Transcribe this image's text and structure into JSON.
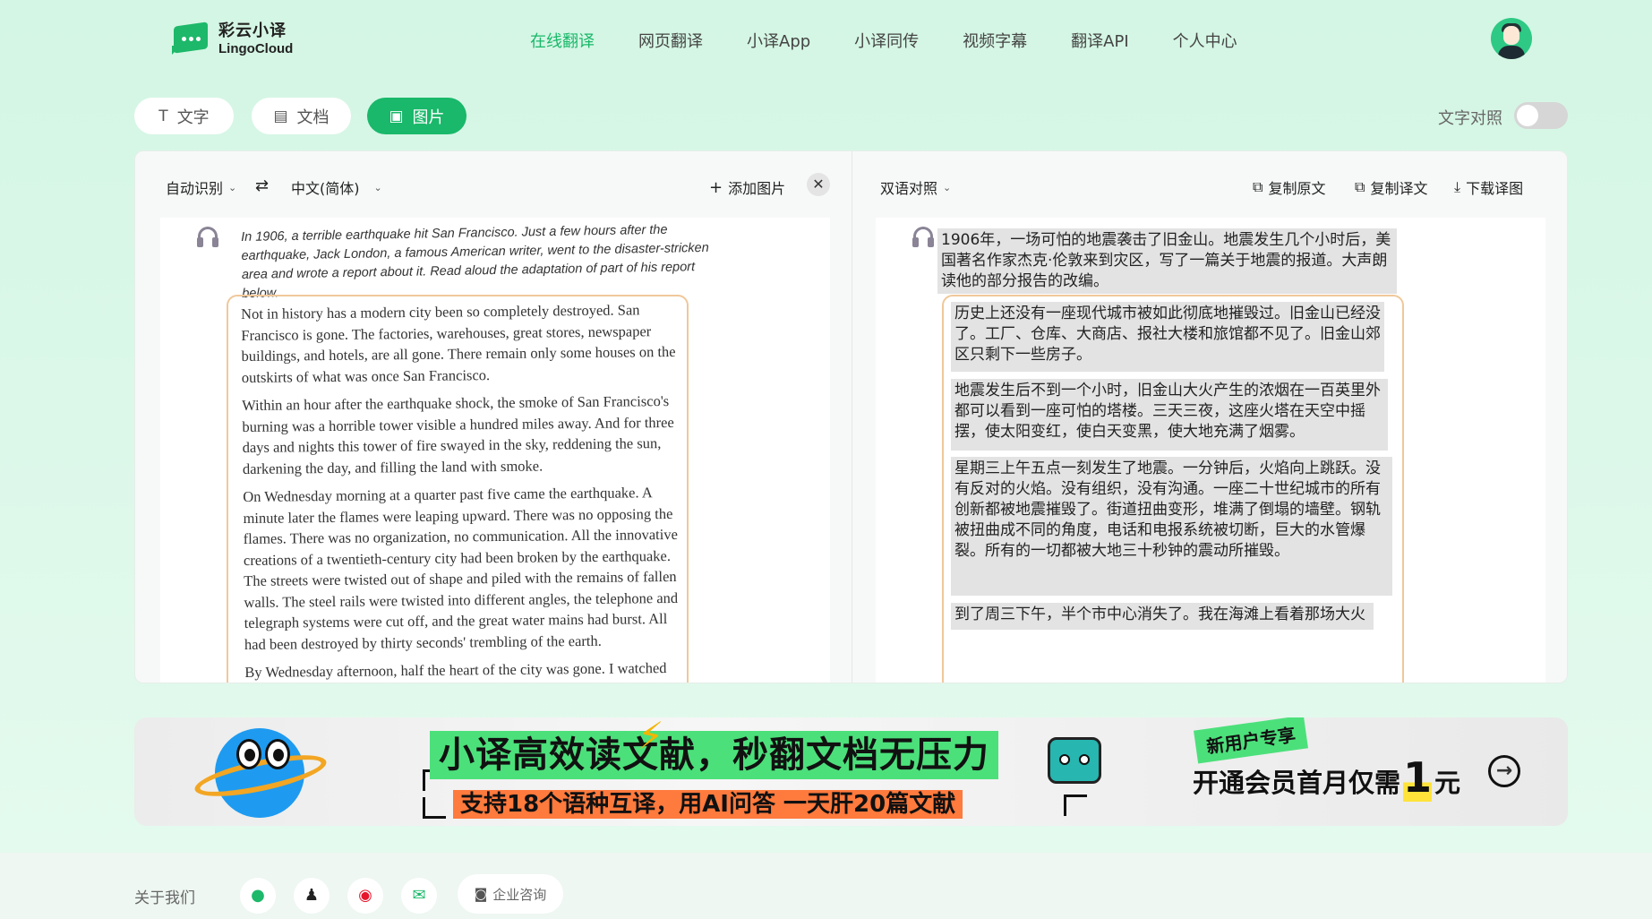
{
  "brand": {
    "cn": "彩云小译",
    "en": "LingoCloud",
    "color": "#19b86a"
  },
  "nav": [
    "在线翻译",
    "网页翻译",
    "小译App",
    "小译同传",
    "视频字幕",
    "翻译API",
    "个人中心"
  ],
  "modes": {
    "text": "文字",
    "doc": "文档",
    "image": "图片",
    "active": "图片"
  },
  "toggle": {
    "label": "文字对照",
    "on": false
  },
  "left_toolbar": {
    "source_lang": "自动识别",
    "swap_icon": "swap-icon",
    "target_lang": "中文(简体)",
    "add_image": "添加图片"
  },
  "right_toolbar": {
    "view_mode": "双语对照",
    "copy_source": "复制原文",
    "copy_translation": "复制译文",
    "download": "下载译图"
  },
  "source_image": {
    "intro": "In 1906, a terrible earthquake hit San Francisco. Just a few hours after the earthquake, Jack London, a famous American writer, went to the disaster-stricken area and wrote a report about it. Read aloud the adaptation of part of his report below.",
    "p1": "Not in history has a modern city been so completely destroyed. San Francisco is gone. The factories, warehouses, great stores, newspaper buildings, and hotels, are all gone. There remain only some houses on the outskirts of what was once San Francisco.",
    "p2": "Within an hour after the earthquake shock, the smoke of San Francisco's burning was a horrible tower visible a hundred miles away. And for three days and nights this tower of fire swayed in the sky, reddening the sun, darkening the day, and filling the land with smoke.",
    "p3": "On Wednesday morning at a quarter past five came the earthquake. A minute later the flames were leaping upward. There was no opposing the flames. There was no organization, no communication. All the innovative creations of a twentieth-century city had been broken by the earthquake. The streets were twisted out of shape and piled with the remains of fallen walls. The steel rails were twisted into different angles, the telephone and telegraph systems were cut off, and the great water mains had burst. All had been destroyed by thirty seconds' trembling of the earth.",
    "p4": "By Wednesday afternoon, half the heart of the city was gone. I watched the"
  },
  "translated_image": {
    "intro": "1906年，一场可怕的地震袭击了旧金山。地震发生几个小时后，美国著名作家杰克·伦敦来到灾区，写了一篇关于地震的报道。大声朗读他的部分报告的改编。",
    "p1": "历史上还没有一座现代城市被如此彻底地摧毁过。旧金山已经没了。工厂、仓库、大商店、报社大楼和旅馆都不见了。旧金山郊区只剩下一些房子。",
    "p2": "地震发生后不到一个小时，旧金山大火产生的浓烟在一百英里外都可以看到一座可怕的塔楼。三天三夜，这座火塔在天空中摇摆，使太阳变红，使白天变黑，使大地充满了烟雾。",
    "p3": "星期三上午五点一刻发生了地震。一分钟后，火焰向上跳跃。没有反对的火焰。没有组织，没有沟通。一座二十世纪城市的所有创新都被地震摧毁了。街道扭曲变形，堆满了倒塌的墙壁。钢轨被扭曲成不同的角度，电话和电报系统被切断，巨大的水管爆裂。所有的一切都被大地三十秒钟的震动所摧毁。",
    "p4": "到了周三下午，半个市中心消失了。我在海滩上看着那场大火"
  },
  "banner": {
    "headline": "小译高效读文献，秒翻文档无压力",
    "subline": "支持18个语种互译，用AI问答 一天肝20篇文献",
    "tag": "新用户专享",
    "offer_prefix": "开通会员首月仅需",
    "offer_num": "1",
    "offer_unit": "元"
  },
  "footer": {
    "about": "关于我们",
    "consult": "企业咨询",
    "icons": [
      "wechat-icon",
      "qq-icon",
      "weibo-icon",
      "email-icon"
    ]
  }
}
